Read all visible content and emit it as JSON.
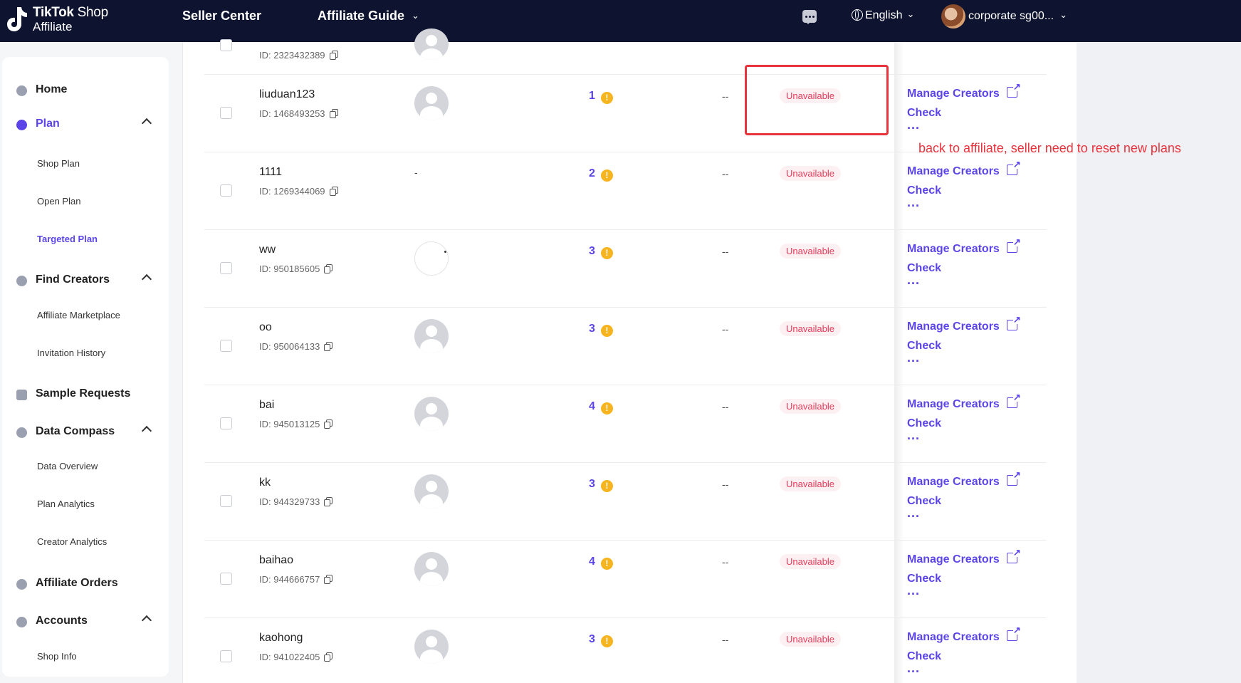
{
  "topbar": {
    "brand_line1": "TikTok",
    "brand_shop": "Shop",
    "brand_line2": "Affiliate",
    "nav": [
      "Seller Center",
      "Affiliate Guide"
    ],
    "language": "English",
    "account": "corporate sg00..."
  },
  "sidebar": {
    "items": [
      {
        "label": "Home"
      },
      {
        "label": "Plan",
        "active": true,
        "children": [
          "Shop Plan",
          "Open Plan",
          "Targeted Plan"
        ],
        "active_child": "Targeted Plan"
      },
      {
        "label": "Find Creators",
        "children": [
          "Affiliate Marketplace",
          "Invitation History"
        ]
      },
      {
        "label": "Sample Requests"
      },
      {
        "label": "Data Compass",
        "children": [
          "Data Overview",
          "Plan Analytics",
          "Creator Analytics"
        ]
      },
      {
        "label": "Affiliate Orders"
      },
      {
        "label": "Accounts",
        "children": [
          "Shop Info"
        ]
      }
    ]
  },
  "table": {
    "partial_row_id": "ID: 2323432389",
    "rows": [
      {
        "name": "liuduan123",
        "id": "ID: 1468493253",
        "avatar": true,
        "level": "1",
        "col": "--",
        "status": "Unavailable"
      },
      {
        "name": "1111",
        "id": "ID: 1269344069",
        "avatar_text": "-",
        "level": "2",
        "col": "--",
        "status": "Unavailable"
      },
      {
        "name": "ww",
        "id": "ID: 950185605",
        "avatar_loading": true,
        "level": "3",
        "col": "--",
        "status": "Unavailable"
      },
      {
        "name": "oo",
        "id": "ID: 950064133",
        "avatar": true,
        "level": "3",
        "col": "--",
        "status": "Unavailable"
      },
      {
        "name": "bai",
        "id": "ID: 945013125",
        "avatar": true,
        "level": "4",
        "col": "--",
        "status": "Unavailable"
      },
      {
        "name": "kk",
        "id": "ID: 944329733",
        "avatar": true,
        "level": "3",
        "col": "--",
        "status": "Unavailable"
      },
      {
        "name": "baihao",
        "id": "ID: 944666757",
        "avatar": true,
        "level": "4",
        "col": "--",
        "status": "Unavailable"
      },
      {
        "name": "kaohong",
        "id": "ID: 941022405",
        "avatar": true,
        "level": "3",
        "col": "--",
        "status": "Unavailable"
      }
    ],
    "actions": {
      "manage": "Manage Creators",
      "check": "Check",
      "more": "..."
    },
    "warning_glyph": "!"
  },
  "annotation": {
    "text": "back to affiliate, seller need to reset new plans",
    "color": "#e8323c"
  },
  "colors": {
    "accent": "#5b45e8",
    "topbar": "#0e1330",
    "status_red": "#e63b5b",
    "warning": "#f6b51e"
  },
  "icons": [
    "tiktok-logo-icon",
    "chevron-down-icon",
    "chat-icon",
    "globe-icon",
    "copy-icon",
    "warning-icon",
    "external-link-icon",
    "more-icon"
  ]
}
